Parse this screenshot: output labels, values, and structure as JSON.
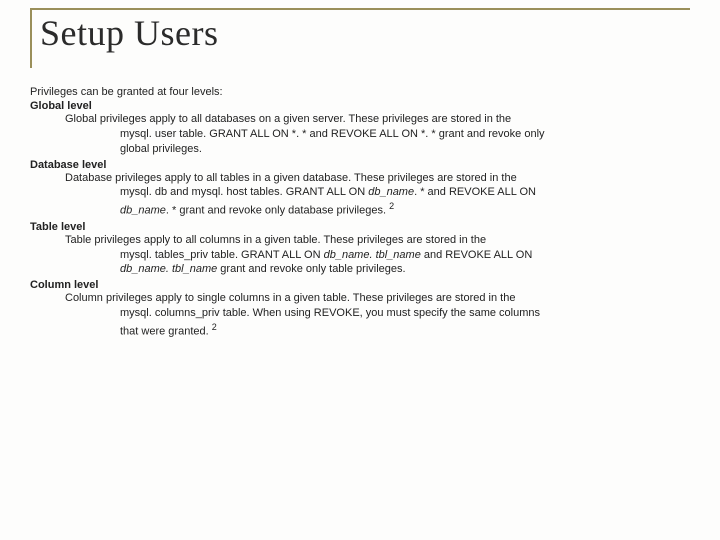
{
  "title": "Setup Users",
  "intro": "Privileges can be granted at four levels:",
  "levels": {
    "global": {
      "title": "Global level",
      "l1": "Global privileges apply to all databases on a given server. These privileges are stored in the",
      "l2": "mysql. user table. GRANT ALL ON *. * and REVOKE ALL ON *. * grant and revoke only",
      "l3": "global privileges."
    },
    "database": {
      "title": "Database level",
      "l1": "Database privileges apply to all tables in a given database. These privileges are stored in the",
      "l2a": "mysql. db and mysql. host tables. GRANT ALL ON ",
      "l2b": "db_name",
      "l2c": ". * and REVOKE ALL ON",
      "l3a": "db_name",
      "l3b": ". * grant and revoke only database privileges. ",
      "fn": "2"
    },
    "table": {
      "title": "Table level",
      "l1": "Table privileges apply to all columns in a given table. These privileges are stored in the",
      "l2a": "mysql. tables_priv table. GRANT ALL ON ",
      "l2b": "db_name. tbl_name",
      "l2c": " and REVOKE ALL ON",
      "l3a": "db_name. tbl_name",
      "l3b": " grant and revoke only table privileges."
    },
    "column": {
      "title": "Column level",
      "l1": "Column privileges apply to single columns in a given table. These privileges are stored in the",
      "l2": "mysql. columns_priv table. When using REVOKE, you must specify the same columns",
      "l3": "that were granted. ",
      "fn": "2"
    }
  }
}
